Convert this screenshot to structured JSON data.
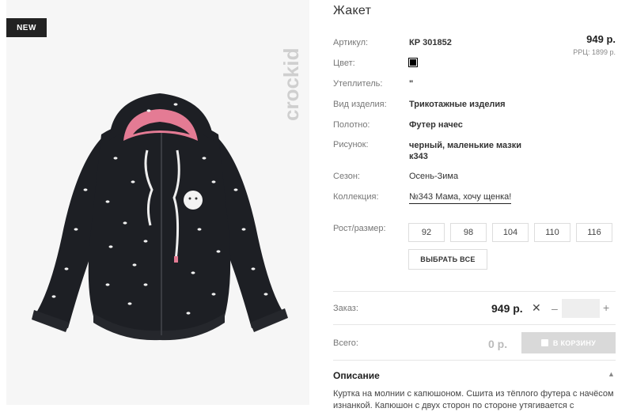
{
  "product": {
    "badge": "NEW",
    "brand": "crockid",
    "title": "Жакет",
    "price": "949 р.",
    "rrp": "РРЦ: 1899 р."
  },
  "details": [
    {
      "label": "Артикул:",
      "value": "КР 301852"
    },
    {
      "label": "Цвет:",
      "value": "",
      "swatch_color": "#000000"
    },
    {
      "label": "Утеплитель:",
      "value": "\""
    },
    {
      "label": "Вид изделия:",
      "value": "Трикотажные изделия"
    },
    {
      "label": "Полотно:",
      "value": "Футер начес"
    },
    {
      "label": "Рисунок:",
      "value": "черный, маленькие мазки к343"
    },
    {
      "label": "Сезон:",
      "value": "Осень-Зима"
    },
    {
      "label": "Коллекция:",
      "value": "№343 Мама, хочу щенка!"
    }
  ],
  "sizes": {
    "label": "Рост/размер:",
    "options": [
      "92",
      "98",
      "104",
      "110",
      "116"
    ],
    "select_all": "ВЫБРАТЬ ВСЕ"
  },
  "order": {
    "label": "Заказ:",
    "price": "949 р.",
    "remove": "✕",
    "minus": "–",
    "qty": "",
    "plus": "+"
  },
  "total": {
    "label": "Всего:",
    "value": "0 р.",
    "cart_button": "В КОРЗИНУ"
  },
  "description": {
    "heading": "Описание",
    "text": "Куртка на молнии с капюшоном. Сшита из тёплого футера с начёсом изнанкой. Капюшон с двух сторон по стороне утягивается с"
  },
  "colors": {
    "jacket": "#1d1f24",
    "hood_lining": "#e47b94",
    "photo_bg": "#f6f6f6"
  }
}
